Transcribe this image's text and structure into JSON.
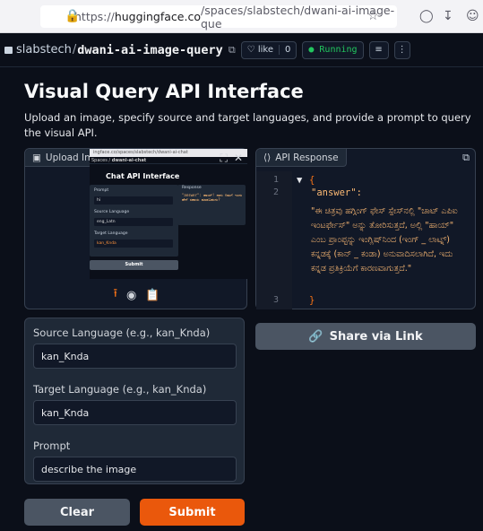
{
  "browser": {
    "url_prefix": "https://",
    "url_host": "huggingface.co",
    "url_path": "/spaces/slabstech/dwani-ai-image-que"
  },
  "space": {
    "owner": "slabstech",
    "name": "dwani-ai-image-query",
    "like_label": "like",
    "like_count": "0",
    "status": "Running"
  },
  "app": {
    "title": "Visual Query API Interface",
    "description": "Upload an image, specify source and target languages, and provide a prompt to query the visual API."
  },
  "image_panel": {
    "label": "Upload Image",
    "screenshot": {
      "url": "ingface.co/spaces/slabstech/dwani-ai-chat",
      "space_owner": "Spaces",
      "space_name": "dwani-ai-chat",
      "title": "Chat API Interface",
      "prompt_label": "Prompt",
      "prompt_value": "hi",
      "source_label": "Source Language",
      "source_value": "eng_Latn",
      "target_label": "Target Language",
      "target_value": "kan_Knda",
      "submit_label": "Submit",
      "response_label": "Response",
      "response_text": "\"answer\": ಹಾಯ್! ನಾನು ನಿಮಗೆ ಇಂದು ಹೇಗೆ ಸಹಾಯ ಮಾಡಬಹುದು?"
    }
  },
  "api_panel": {
    "label": "API Response",
    "line_numbers": [
      "1",
      "2",
      "3"
    ],
    "open_brace": "{",
    "key": "\"answer\":",
    "value": "\"ಈ ಚಿತ್ರವು ಹಗ್ಗಿಂಗ್ ಫೇಸ್ ಸ್ಪೇಸ್‌ನಲ್ಲಿ \"ಚಾಟ್ ಎಪಿಐ ಇಂಟರ್ಫೇಸ್\" ಅನ್ನು ತೋರಿಸುತ್ತದೆ, ಅಲ್ಲಿ \"ಹಾಯ್\" ಎಂಬ ಪ್ರಾಂಪ್ಟನ್ನು ಇಂಗ್ಲಿಷ್‌ನಿಂದ (ಇಂಗ್ _ ಲಾಟ್ನ್) ಕನ್ನಡಕ್ಕೆ (ಕಾನ್ _ ಕಂಡಾ) ಅನುವಾದಿಸಲಾಗಿದೆ, ಇದು ಕನ್ನಡ ಪ್ರತಿಕ್ರಿಯೆಗೆ ಕಾರಣವಾಗುತ್ತದೆ.\"",
    "close_brace": "}"
  },
  "share_label": "Share via Link",
  "form": {
    "source_label": "Source Language (e.g., kan_Knda)",
    "source_value": "kan_Knda",
    "target_label": "Target Language (e.g., kan_Knda)",
    "target_value": "kan_Knda",
    "prompt_label": "Prompt",
    "prompt_value": "describe the image"
  },
  "buttons": {
    "clear": "Clear",
    "submit": "Submit"
  }
}
